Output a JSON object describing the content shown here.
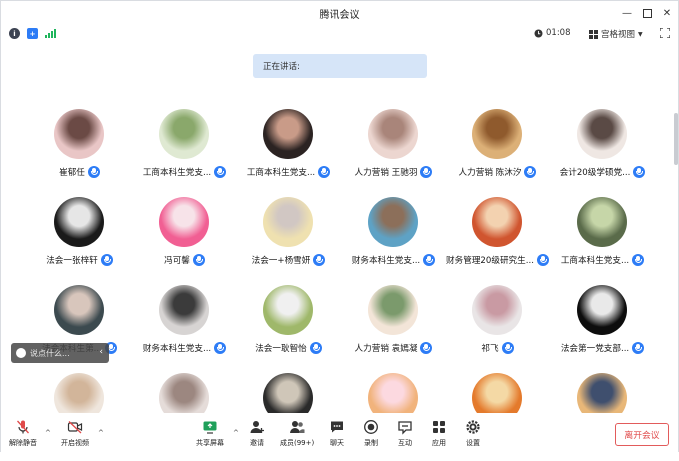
{
  "window": {
    "title": "腾讯会议"
  },
  "status": {
    "timer": "01:08",
    "view_label": "宫格视图"
  },
  "speaking": {
    "label": "正在讲话:"
  },
  "participants": [
    {
      "name": "崔郁任",
      "c1": "#e9c6c6",
      "c2": "#6b4a45"
    },
    {
      "name": "工商本科生党支...",
      "c1": "#dfe9d2",
      "c2": "#8aa86b"
    },
    {
      "name": "工商本科生党支...",
      "c1": "#2b2322",
      "c2": "#c99b88"
    },
    {
      "name": "人力营销 王驰羽",
      "c1": "#ecd6d0",
      "c2": "#a9857a"
    },
    {
      "name": "人力营销 陈沐汐",
      "c1": "#dcb077",
      "c2": "#8f5a2d"
    },
    {
      "name": "会计20级学硕党...",
      "c1": "#efe7e3",
      "c2": "#5a4a45"
    },
    {
      "name": "法会一张梓轩",
      "c1": "#1a1a1a",
      "c2": "#e6e6e6"
    },
    {
      "name": "冯可馨",
      "c1": "#f15f93",
      "c2": "#f7e3e9"
    },
    {
      "name": "法会一+杨雪妍",
      "c1": "#efe1b0",
      "c2": "#d1c7c3"
    },
    {
      "name": "财务本科生党支...",
      "c1": "#5ea2c5",
      "c2": "#8c6f5a"
    },
    {
      "name": "财务管理20级研究生...",
      "c1": "#d0552f",
      "c2": "#f3d2b0"
    },
    {
      "name": "工商本科生党支...",
      "c1": "#5a6b4a",
      "c2": "#c6d6a8"
    },
    {
      "name": "法会本科生第...",
      "c1": "#3c4a4f",
      "c2": "#d8c6bc"
    },
    {
      "name": "财务本科生党支...",
      "c1": "#d7d4d3",
      "c2": "#3b3b3b"
    },
    {
      "name": "法会一耿智怡",
      "c1": "#9fb86a",
      "c2": "#f0f0f0"
    },
    {
      "name": "人力营销 袁嫣凝",
      "c1": "#f3e5d8",
      "c2": "#7b9a6c"
    },
    {
      "name": "祁飞",
      "c1": "#e9e5e6",
      "c2": "#c99aa3"
    },
    {
      "name": "法会第一党支部...",
      "c1": "#0d0d0d",
      "c2": "#e9e9e9"
    },
    {
      "name": "",
      "c1": "#efe6dd",
      "c2": "#d2b59a"
    },
    {
      "name": "",
      "c1": "#e5dcd9",
      "c2": "#9c8780"
    },
    {
      "name": "",
      "c1": "#2a2a2a",
      "c2": "#cfc6b8"
    },
    {
      "name": "",
      "c1": "#f1b37c",
      "c2": "#fcd9e0"
    },
    {
      "name": "",
      "c1": "#e47a2c",
      "c2": "#f4d9a5"
    },
    {
      "name": "",
      "c1": "#e8b778",
      "c2": "#3f4f6e"
    }
  ],
  "chat_bubble": {
    "text": "说点什么..."
  },
  "toolbar": {
    "mute": "解除静音",
    "video": "开启视频",
    "share": "共享屏幕",
    "invite": "邀请",
    "members": "成员(99+)",
    "chat": "聊天",
    "record": "录制",
    "interact": "互动",
    "apps": "应用",
    "settings": "设置",
    "leave": "离开会议"
  }
}
